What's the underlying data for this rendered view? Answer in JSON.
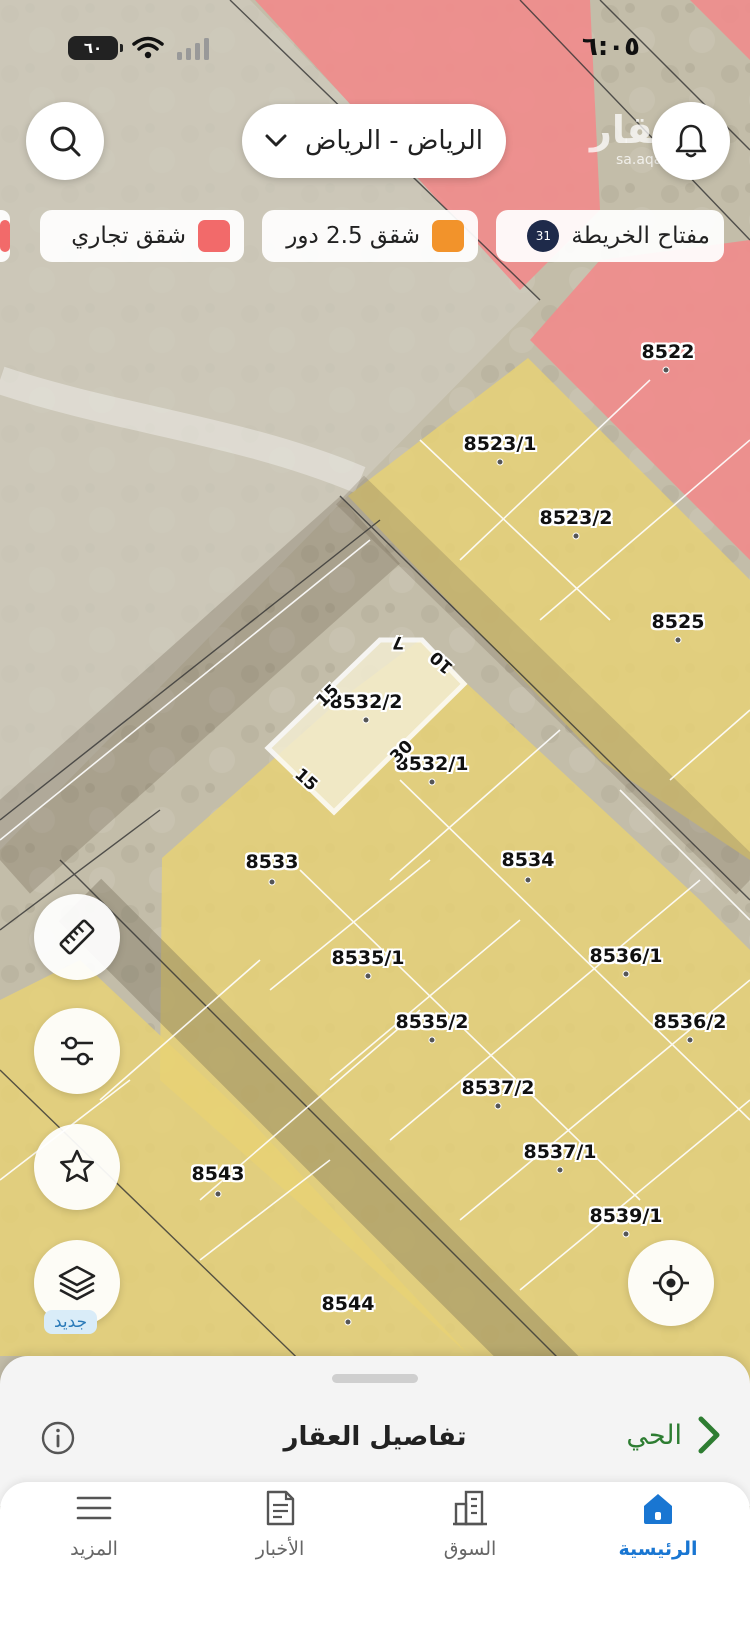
{
  "status_bar": {
    "time": "٦:٠٥",
    "battery": "٦٠"
  },
  "watermark": {
    "brand": "عقار",
    "domain": "sa.aqar"
  },
  "header": {
    "city": "الرياض - الرياض"
  },
  "legend_chips": {
    "map_key": {
      "label": "مفتاح الخريطة",
      "count": "31"
    },
    "apartments": {
      "label": "شقق 2.5 دور",
      "color": "#f2932b"
    },
    "commercial": {
      "label": "شقق تجاري",
      "color": "#f26a6a"
    }
  },
  "map": {
    "parcels": [
      {
        "id": "8522"
      },
      {
        "id": "8523/1"
      },
      {
        "id": "8523/2"
      },
      {
        "id": "8525"
      },
      {
        "id": "8532/2"
      },
      {
        "id": "8532/1"
      },
      {
        "id": "8533"
      },
      {
        "id": "8534"
      },
      {
        "id": "8535/1"
      },
      {
        "id": "8536/1"
      },
      {
        "id": "8535/2"
      },
      {
        "id": "8536/2"
      },
      {
        "id": "8537/2"
      },
      {
        "id": "8537/1"
      },
      {
        "id": "8543"
      },
      {
        "id": "8539/1"
      },
      {
        "id": "8544"
      }
    ],
    "dimensions": [
      "7",
      "10",
      "15",
      "30",
      "15"
    ],
    "colors": {
      "residential": "#e8d274",
      "commercial": "#f08c8c",
      "selected": "#f5efd6",
      "ground": "#c7c0ab"
    }
  },
  "tools": {
    "new_badge": "جديد"
  },
  "sheet": {
    "title": "تفاصيل العقار",
    "district": "الحي"
  },
  "tabbar": {
    "home": "الرئيسية",
    "market": "السوق",
    "news": "الأخبار",
    "more": "المزيد",
    "active_color": "#1976d2"
  }
}
